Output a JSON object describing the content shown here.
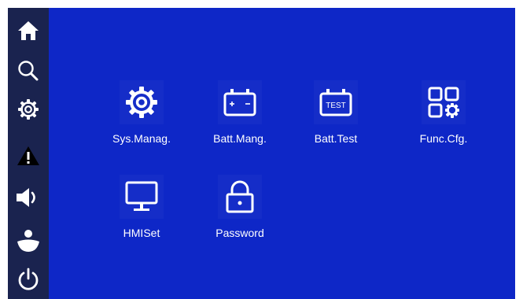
{
  "colors": {
    "background": "#0e27c7",
    "sidebar": "#1a234f",
    "icon": "#ffffff",
    "warning": "#000000",
    "frame": "#ffffff"
  },
  "sidebar": {
    "items": [
      {
        "name": "home",
        "icon": "home-icon"
      },
      {
        "name": "search",
        "icon": "search-icon"
      },
      {
        "name": "settings",
        "icon": "gear-icon"
      },
      {
        "name": "alarm",
        "icon": "warning-icon"
      },
      {
        "name": "sound",
        "icon": "speaker-icon"
      },
      {
        "name": "user",
        "icon": "user-icon"
      },
      {
        "name": "power",
        "icon": "power-icon"
      }
    ]
  },
  "menu": {
    "tiles": [
      {
        "label": "Sys.Manag.",
        "icon": "gear-icon"
      },
      {
        "label": "Batt.Mang.",
        "icon": "battery-icon"
      },
      {
        "label": "Batt.Test",
        "icon": "battery-test-icon",
        "icon_text": "TEST"
      },
      {
        "label": "Func.Cfg.",
        "icon": "function-config-icon"
      },
      {
        "label": "HMISet",
        "icon": "monitor-icon"
      },
      {
        "label": "Password",
        "icon": "lock-icon"
      }
    ]
  }
}
